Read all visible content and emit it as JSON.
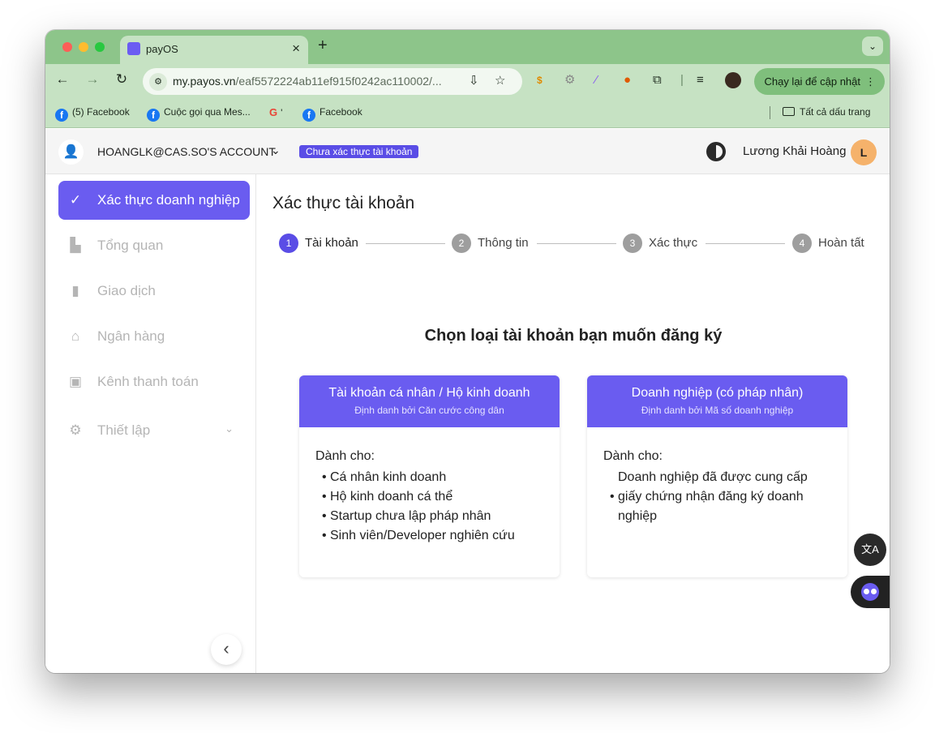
{
  "browser": {
    "tab_title": "payOS",
    "tab_close": "×",
    "new_tab": "+",
    "tab_menu": "⌄",
    "url_host": "my.payos.vn",
    "url_path": "/eaf5572224ab11ef915f0242ac110002/...",
    "update_button": "Chạy lại để cập nhật",
    "bookmarks": [
      {
        "label": "(5) Facebook",
        "icon": "facebook-icon"
      },
      {
        "label": "Cuộc gọi qua Mes...",
        "icon": "facebook-icon"
      },
      {
        "label": "'",
        "icon": "google-icon"
      },
      {
        "label": "Facebook",
        "icon": "facebook-icon"
      }
    ],
    "all_bookmarks": "Tất cả dấu trang"
  },
  "header": {
    "account_name": "HOANGLK@CAS.SO'S ACCOUNT",
    "badge": "Chưa xác thực tài khoản",
    "user_name": "Lương Khải Hoàng",
    "user_initial": "L"
  },
  "sidebar": {
    "items": [
      {
        "label": "Xác thực doanh nghiệp",
        "icon": "user-check-icon"
      },
      {
        "label": "Tổng quan",
        "icon": "dashboard-icon"
      },
      {
        "label": "Giao dịch",
        "icon": "bar-chart-icon"
      },
      {
        "label": "Ngân hàng",
        "icon": "bank-icon"
      },
      {
        "label": "Kênh thanh toán",
        "icon": "wallet-icon"
      },
      {
        "label": "Thiết lập",
        "icon": "gear-icon"
      }
    ]
  },
  "main": {
    "title": "Xác thực tài khoản",
    "steps": [
      {
        "num": "1",
        "label": "Tài khoản"
      },
      {
        "num": "2",
        "label": "Thông tin"
      },
      {
        "num": "3",
        "label": "Xác thực"
      },
      {
        "num": "4",
        "label": "Hoàn tất"
      }
    ],
    "section_title": "Chọn loại tài khoản bạn muốn đăng ký",
    "cards": [
      {
        "title": "Tài khoản cá nhân / Hộ kinh doanh",
        "subtitle": "Định danh bởi Căn cước công dân",
        "for_label": "Dành cho:",
        "items": [
          "Cá nhân kinh doanh",
          "Hộ kinh doanh cá thể",
          "Startup chưa lập pháp nhân",
          "Sinh viên/Developer nghiên cứu"
        ]
      },
      {
        "title": "Doanh nghiệp (có pháp nhân)",
        "subtitle": "Định danh bởi Mã số doanh nghiệp",
        "for_label": "Dành cho:",
        "items": [
          "Doanh nghiệp đã được cung cấp",
          "giấy chứng nhận đăng ký doanh",
          "nghiệp"
        ]
      }
    ]
  },
  "colors": {
    "brand": "#6a5cf0",
    "browser_frame": "#8dc58a",
    "browser_toolbar": "#c6e2c3"
  }
}
